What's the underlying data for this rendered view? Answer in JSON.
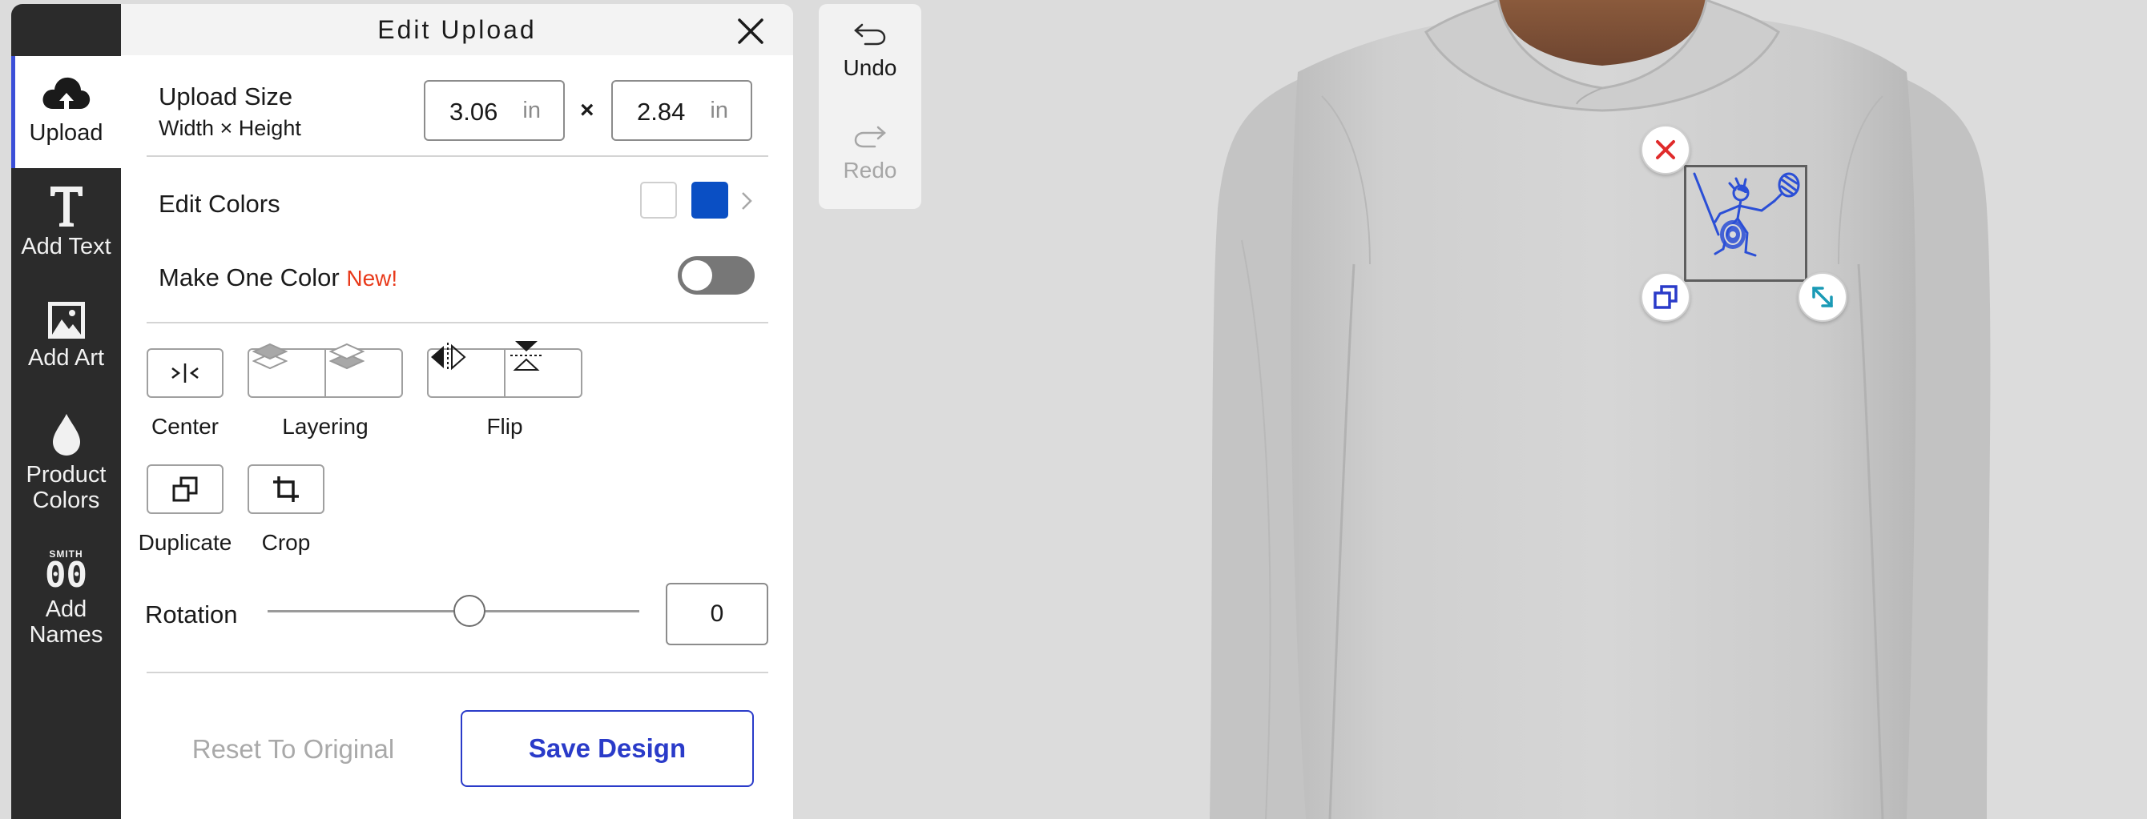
{
  "rail": {
    "items": [
      {
        "label": "Upload",
        "icon": "cloud-upload-icon"
      },
      {
        "label": "Add Text",
        "icon": "text-icon"
      },
      {
        "label": "Add Art",
        "icon": "image-icon"
      },
      {
        "label_line1": "Product",
        "label_line2": "Colors",
        "icon": "droplet-icon"
      },
      {
        "label_line1": "Add",
        "label_line2": "Names",
        "icon": "names-number-icon",
        "icon_text_top": "SMITH",
        "icon_text_num": "00"
      }
    ]
  },
  "panel": {
    "title": "Edit Upload",
    "size": {
      "label": "Upload Size",
      "sublabel": "Width × Height",
      "width": "3.06",
      "height": "2.84",
      "unit": "in",
      "separator": "×"
    },
    "edit_colors": {
      "label": "Edit Colors",
      "colors": [
        "#ffffff",
        "#0a4fc4"
      ]
    },
    "one_color": {
      "label": "Make One Color",
      "badge": "New!",
      "enabled": false
    },
    "tools": {
      "center": "Center",
      "layering": "Layering",
      "flip": "Flip",
      "duplicate": "Duplicate",
      "crop": "Crop"
    },
    "rotation": {
      "label": "Rotation",
      "value": "0",
      "slider_fraction": 0.5
    },
    "reset_label": "Reset To Original",
    "save_label": "Save Design"
  },
  "history": {
    "undo": "Undo",
    "redo": "Redo"
  },
  "colors": {
    "accent": "#2a3bc9",
    "new_badge": "#e8391a",
    "delete_handle": "#e02b2b",
    "duplicate_handle": "#2a3bc9",
    "resize_handle": "#1a9ab5",
    "artwork": "#2b4fd6"
  }
}
